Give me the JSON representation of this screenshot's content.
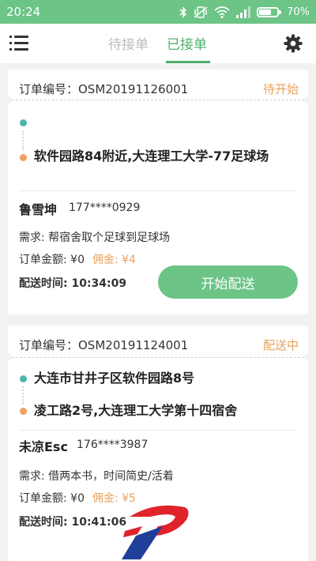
{
  "status_bar": {
    "time": "20:24",
    "battery": "70%",
    "battery_level": 0.7,
    "icons": [
      "bluetooth-icon",
      "vibrate-off-icon",
      "wifi-icon",
      "signal-icon",
      "battery-icon"
    ]
  },
  "header": {
    "tabs": [
      {
        "label": "待接单",
        "active": false
      },
      {
        "label": "已接单",
        "active": true
      }
    ],
    "menu_icon": "menu-icon",
    "settings_icon": "gear-icon"
  },
  "orders": [
    {
      "order_label": "订单编号：OSM20191126001",
      "status": "待开始",
      "pickup_address": "",
      "delivery_address": "软件园路84附近,大连理工大学-77足球场",
      "customer_name": "鲁雪坤",
      "customer_phone": "177****0929",
      "requirement": "需求:   帮宿舍取个足球到足球场",
      "amount": "订单金额: ¥0",
      "commission": "佣金: ¥4",
      "delivery_time": "配送时间: 10:34:09",
      "action_label": "开始配送"
    },
    {
      "order_label": "订单编号：OSM20191124001",
      "status": "配送中",
      "pickup_address": "大连市甘井子区软件园路8号",
      "delivery_address": "凌工路2号,大连理工大学第十四宿舍",
      "customer_name": "未凉Esc",
      "customer_phone": "176****3987",
      "requirement": "需求:   借两本书，时间简史/活着",
      "amount": "订单金额: ¥0",
      "commission": "佣金: ¥5",
      "delivery_time": "配送时间: 10:41:06"
    }
  ],
  "colors": {
    "accent_green": "#6cc486",
    "tab_green": "#4caf6a",
    "status_orange": "#e8a25c",
    "pickup_dot": "#4db6ac",
    "delivery_dot": "#f0a062",
    "logo_red": "#e0242b",
    "logo_blue": "#1f3f9a"
  }
}
